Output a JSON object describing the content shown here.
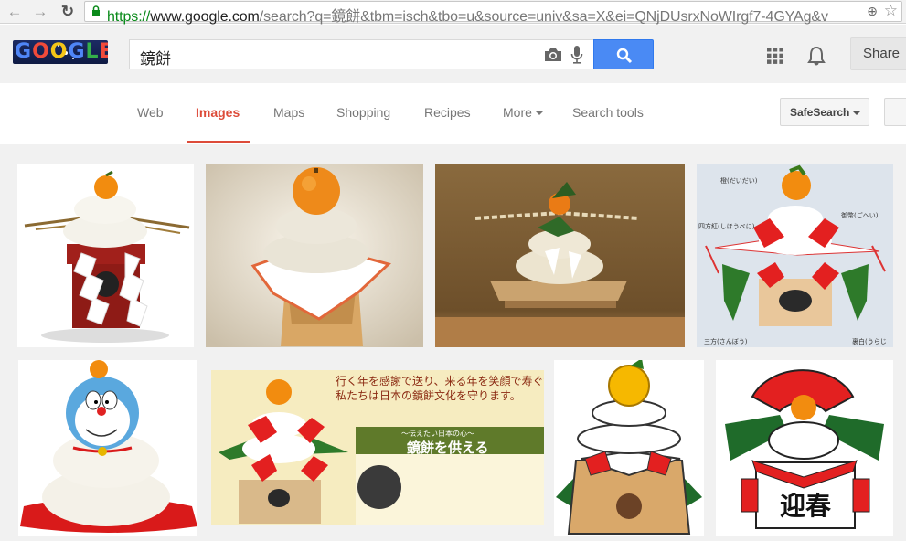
{
  "browser": {
    "url_scheme": "https://",
    "url_host": "www.google.com",
    "url_path": "/search?q=鏡餅&tbm=isch&tbo=u&source=univ&sa=X&ei=QNjDUsrxNoWIrgf7-4GYAg&v"
  },
  "logo": {
    "letters": [
      "G",
      "O",
      "O",
      "G",
      "L",
      "E"
    ]
  },
  "search": {
    "query": "鏡餅"
  },
  "header": {
    "share_label": "Share"
  },
  "tabs": [
    {
      "label": "Web"
    },
    {
      "label": "Images",
      "active": true
    },
    {
      "label": "Maps"
    },
    {
      "label": "Shopping"
    },
    {
      "label": "Recipes"
    },
    {
      "label": "More"
    },
    {
      "label": "Search tools"
    }
  ],
  "safesearch_label": "SafeSearch",
  "results": [
    {
      "label": "kagami-mochi-red-stand"
    },
    {
      "label": "kagami-mochi-paper-stand"
    },
    {
      "label": "kagami-mochi-wooden-tray"
    },
    {
      "label": "kagami-mochi-diagram",
      "callouts": [
        "橙(だいだい)",
        "御幣(ごへい)",
        "四方紅(しほうべに)",
        "三方(さんぼう)",
        "裏白(うらじろ)"
      ]
    },
    {
      "label": "doraemon-kagami-mochi"
    },
    {
      "label": "kagami-mochi-banner",
      "headline": [
        "行く年を感謝で送り、来る年を笑顔で寿ぐ鏡餅。",
        "私たちは日本の鏡餅文化を守ります。"
      ],
      "subtitle": "～伝えたい日本の心～",
      "title": "鏡餅を供える"
    },
    {
      "label": "kagami-mochi-illustration-pine"
    },
    {
      "label": "kagami-mochi-fan-illustration",
      "sign": "迎春"
    }
  ]
}
